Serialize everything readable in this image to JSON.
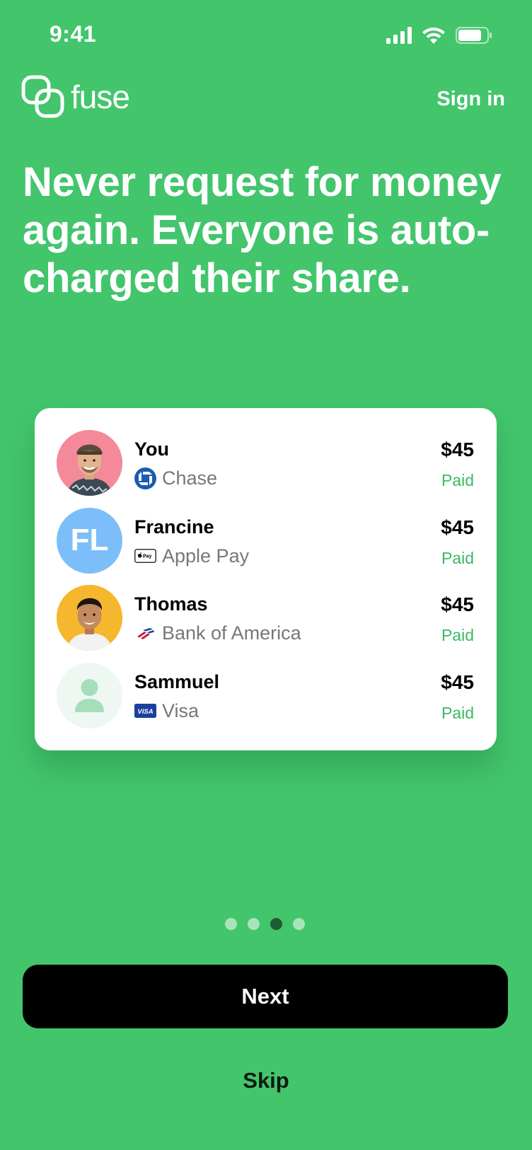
{
  "status_bar": {
    "time": "9:41"
  },
  "header": {
    "logo_text": "fuse",
    "sign_in_label": "Sign in"
  },
  "headline": "Never request for money again. Everyone is auto-charged their share.",
  "participants": [
    {
      "name": "You",
      "payment_method": "Chase",
      "amount": "$45",
      "status": "Paid",
      "avatar": "photo"
    },
    {
      "name": "Francine",
      "payment_method": "Apple Pay",
      "amount": "$45",
      "status": "Paid",
      "avatar": "initials",
      "initials": "FL"
    },
    {
      "name": "Thomas",
      "payment_method": "Bank of America",
      "amount": "$45",
      "status": "Paid",
      "avatar": "photo"
    },
    {
      "name": "Sammuel",
      "payment_method": "Visa",
      "amount": "$45",
      "status": "Paid",
      "avatar": "placeholder"
    }
  ],
  "pager": {
    "total": 4,
    "active_index": 2
  },
  "buttons": {
    "next_label": "Next",
    "skip_label": "Skip"
  },
  "colors": {
    "background": "#43C56C",
    "paid": "#3BB864",
    "initials_avatar": "#7CBEF9",
    "active_dot": "#1E5B33"
  }
}
